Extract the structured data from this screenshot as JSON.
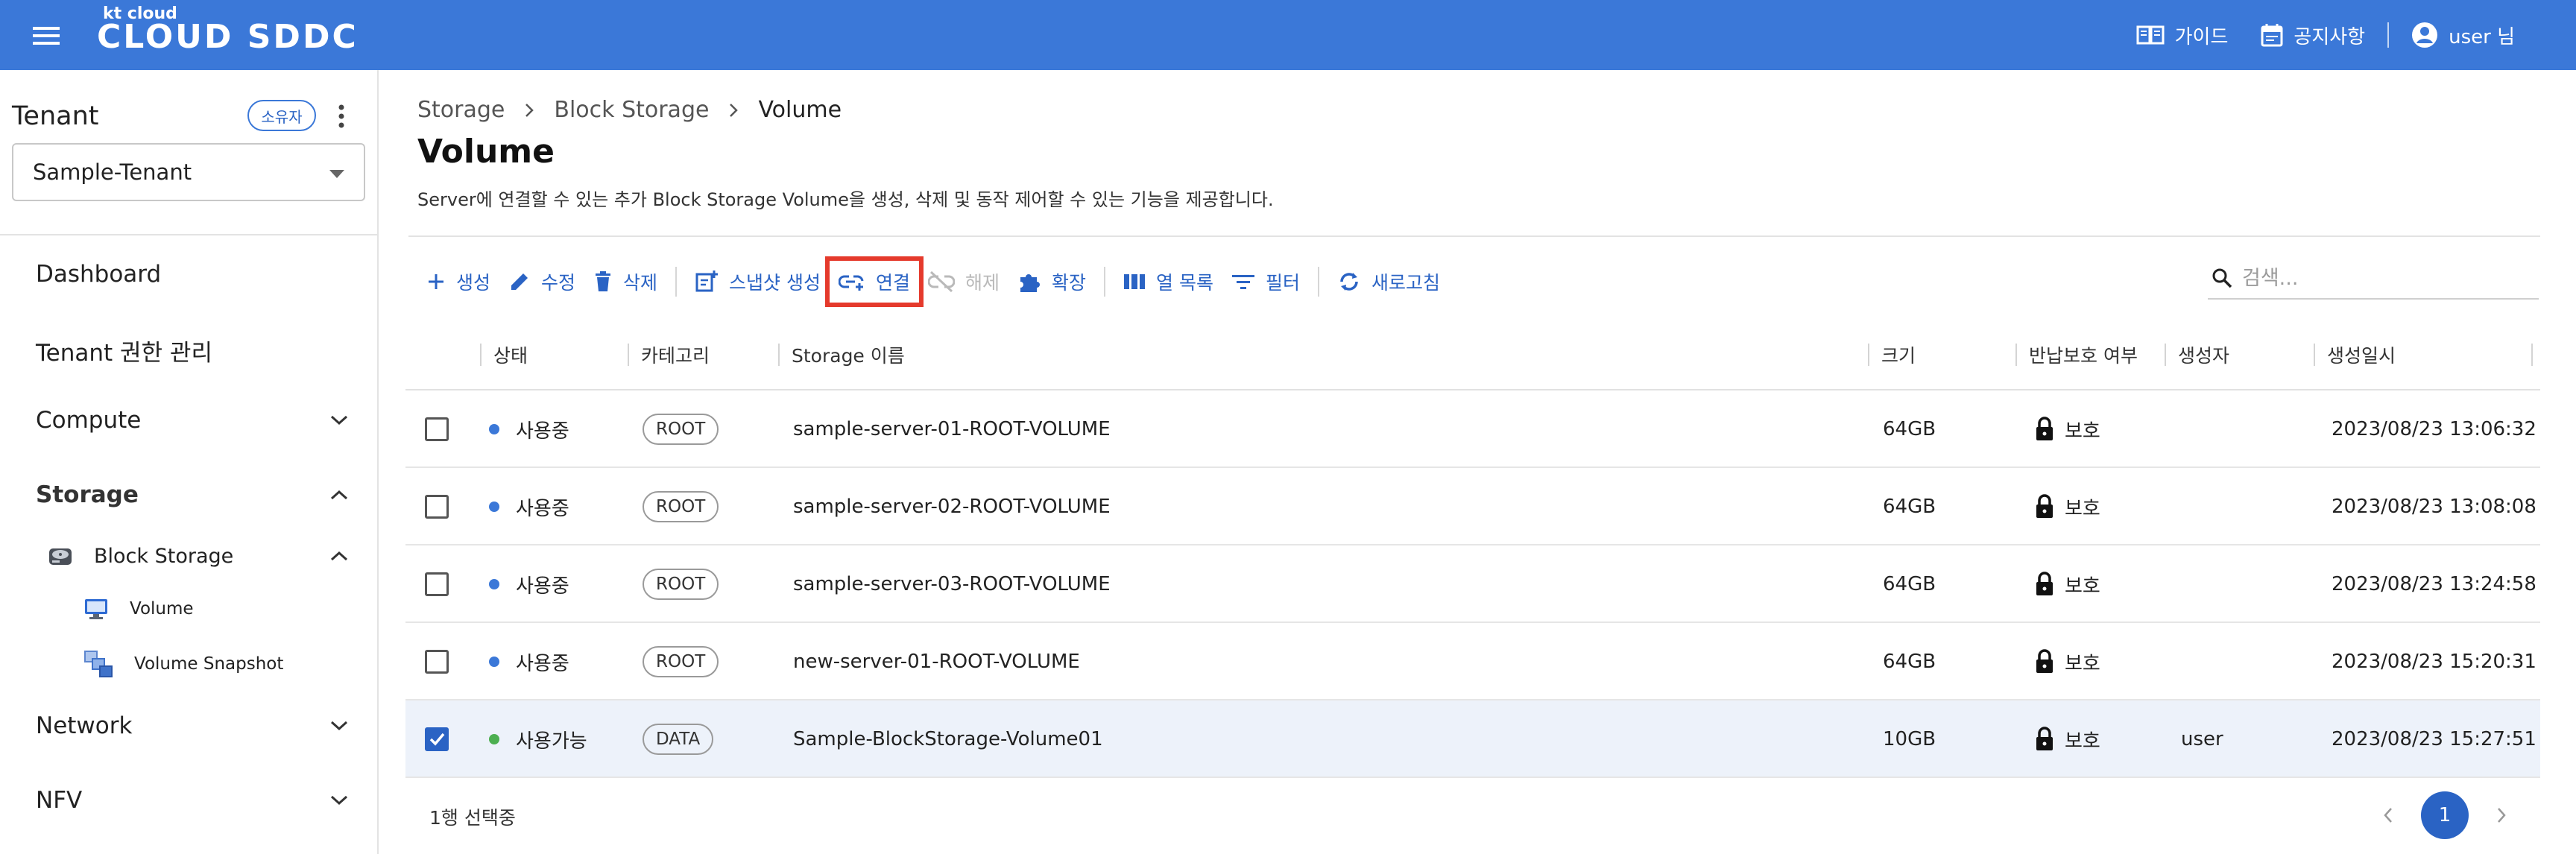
{
  "header": {
    "logo_small": "kt cloud",
    "logo_big": "CLOUD SDDC",
    "guide_label": "가이드",
    "notice_label": "공지사항",
    "user_label": "user 님"
  },
  "sidebar": {
    "tenant_title": "Tenant",
    "owner_badge": "소유자",
    "tenant_selected": "Sample-Tenant",
    "items": [
      {
        "label": "Dashboard"
      },
      {
        "label": "Tenant 권한 관리"
      },
      {
        "label": "Compute"
      },
      {
        "label": "Storage"
      },
      {
        "label": "Block Storage"
      },
      {
        "label": "Volume"
      },
      {
        "label": "Volume Snapshot"
      },
      {
        "label": "Network"
      },
      {
        "label": "NFV"
      }
    ]
  },
  "breadcrumb": [
    "Storage",
    "Block Storage",
    "Volume"
  ],
  "page": {
    "title": "Volume",
    "description": "Server에 연결할 수 있는 추가 Block Storage Volume을 생성, 삭제 및 동작 제어할 수 있는 기능을 제공합니다."
  },
  "toolbar": {
    "create": "생성",
    "edit": "수정",
    "delete": "삭제",
    "snapshot": "스냅샷 생성",
    "attach": "연결",
    "detach": "해제",
    "extend": "확장",
    "columns": "열 목록",
    "filter": "필터",
    "refresh": "새로고침"
  },
  "search": {
    "placeholder": "검색..."
  },
  "table": {
    "headers": [
      "상태",
      "카테고리",
      "Storage 이름",
      "크기",
      "반납보호 여부",
      "생성자",
      "생성일시"
    ],
    "rows": [
      {
        "checked": false,
        "status": "사용중",
        "category": "ROOT",
        "name": "sample-server-01-ROOT-VOLUME",
        "size": "64GB",
        "protect": "보호",
        "creator": "",
        "created": "2023/08/23 13:06:32"
      },
      {
        "checked": false,
        "status": "사용중",
        "category": "ROOT",
        "name": "sample-server-02-ROOT-VOLUME",
        "size": "64GB",
        "protect": "보호",
        "creator": "",
        "created": "2023/08/23 13:08:08"
      },
      {
        "checked": false,
        "status": "사용중",
        "category": "ROOT",
        "name": "sample-server-03-ROOT-VOLUME",
        "size": "64GB",
        "protect": "보호",
        "creator": "",
        "created": "2023/08/23 13:24:58"
      },
      {
        "checked": false,
        "status": "사용중",
        "category": "ROOT",
        "name": "new-server-01-ROOT-VOLUME",
        "size": "64GB",
        "protect": "보호",
        "creator": "",
        "created": "2023/08/23 15:20:31"
      },
      {
        "checked": true,
        "status": "사용가능",
        "category": "DATA",
        "name": "Sample-BlockStorage-Volume01",
        "size": "10GB",
        "protect": "보호",
        "creator": "user",
        "created": "2023/08/23 15:27:51"
      }
    ]
  },
  "footer": {
    "selected_text": "1행 선택중",
    "page": "1"
  },
  "colors": {
    "primary": "#3b78d8",
    "accent": "#2a63c4",
    "in_use": "#3b78d8",
    "available": "#4caf50",
    "highlight": "#e53a2c"
  }
}
